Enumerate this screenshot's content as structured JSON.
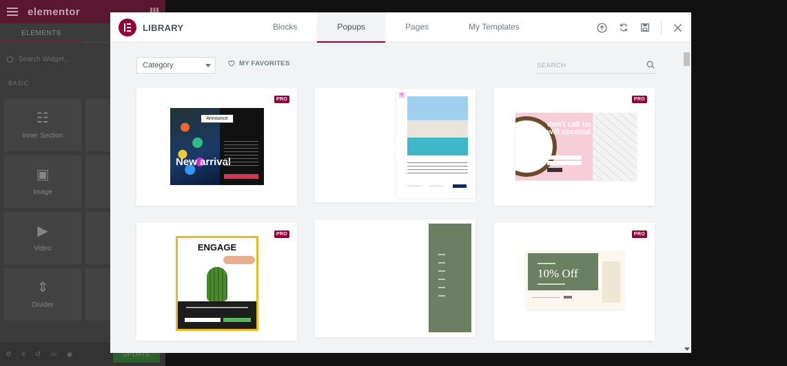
{
  "editor": {
    "logo": "elementor",
    "tabs": [
      "ELEMENTS"
    ],
    "search_placeholder": "Search Widget...",
    "section_label": "BASIC",
    "widgets": [
      {
        "label": "Inner Section",
        "icon": "columns-icon"
      },
      {
        "label": "Image",
        "icon": "image-icon"
      },
      {
        "label": "Video",
        "icon": "video-icon"
      },
      {
        "label": "Divider",
        "icon": "divider-icon"
      }
    ],
    "update_label": "UPDATE"
  },
  "modal": {
    "title": "LIBRARY",
    "tabs": [
      "Blocks",
      "Popups",
      "Pages",
      "My Templates"
    ],
    "active_tab": "Popups",
    "category_label": "Category",
    "favorites_label": "MY FAVORITES",
    "search_placeholder": "SEARCH",
    "pro_label": "PRO",
    "templates": [
      {
        "id": "announce",
        "badge": "Announce",
        "heading": "New arrival"
      },
      {
        "id": "property"
      },
      {
        "id": "coconut",
        "heading": "don't call us we will coconut you"
      },
      {
        "id": "engage",
        "heading": "ENGAGE"
      },
      {
        "id": "sidebar-menu"
      },
      {
        "id": "discount",
        "heading": "10% Off"
      }
    ]
  },
  "colors": {
    "accent": "#92003b",
    "modal_bg": "#f1f3f5"
  }
}
